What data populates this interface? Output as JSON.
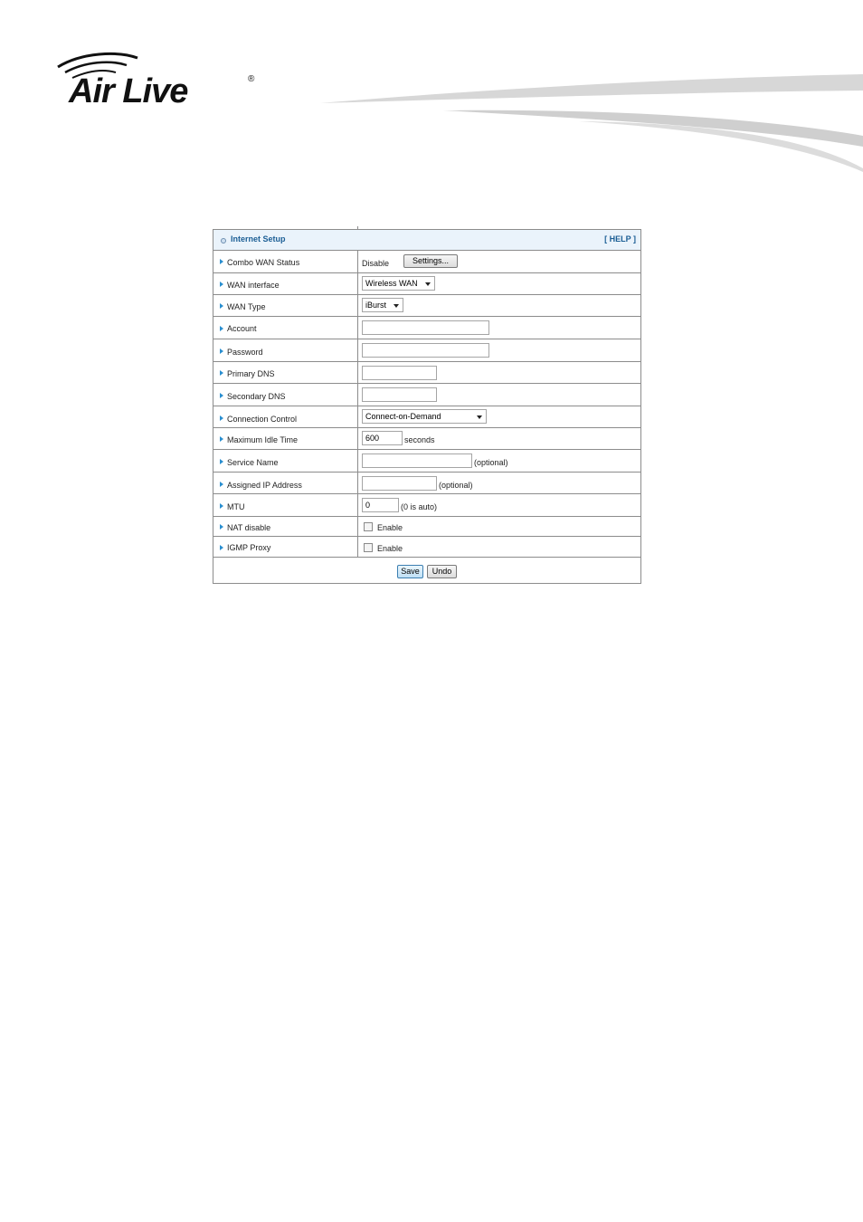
{
  "brand": {
    "logo_text": "Air Live",
    "registered_mark": "®"
  },
  "panel": {
    "title": "Internet Setup",
    "help_label": "[ HELP ]",
    "rows": {
      "combo_wan_status": {
        "label": "Combo WAN Status",
        "value": "Disable",
        "button": "Settings..."
      },
      "wan_interface": {
        "label": "WAN interface",
        "selected": "Wireless WAN"
      },
      "wan_type": {
        "label": "WAN Type",
        "selected": "iBurst"
      },
      "account": {
        "label": "Account",
        "value": ""
      },
      "password": {
        "label": "Password",
        "value": ""
      },
      "primary_dns": {
        "label": "Primary DNS",
        "value": ""
      },
      "secondary_dns": {
        "label": "Secondary DNS",
        "value": ""
      },
      "connection_control": {
        "label": "Connection Control",
        "selected": "Connect-on-Demand"
      },
      "max_idle_time": {
        "label": "Maximum Idle Time",
        "value": "600",
        "unit": "seconds"
      },
      "service_name": {
        "label": "Service Name",
        "value": "",
        "hint": "(optional)"
      },
      "assigned_ip": {
        "label": "Assigned IP Address",
        "value": "",
        "hint": "(optional)"
      },
      "mtu": {
        "label": "MTU",
        "value": "0",
        "hint": "(0 is auto)"
      },
      "nat_disable": {
        "label": "NAT disable",
        "checkbox_label": "Enable",
        "checked": false
      },
      "igmp_proxy": {
        "label": "IGMP Proxy",
        "checkbox_label": "Enable",
        "checked": false
      }
    },
    "actions": {
      "save": "Save",
      "undo": "Undo"
    }
  },
  "colors": {
    "header_bg": "#eaf3fb",
    "header_text": "#1b5e95",
    "arrow": "#2a8fd0",
    "border": "#8c8c8c"
  },
  "icons": [
    "swoosh-logo-icon",
    "header-bullet-icon",
    "row-arrow-icon",
    "dropdown-caret-icon"
  ]
}
